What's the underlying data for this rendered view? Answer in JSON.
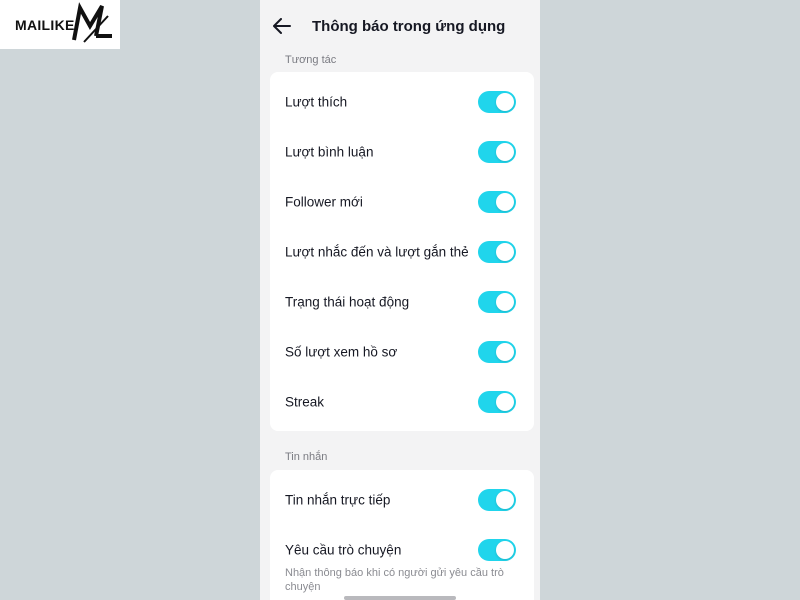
{
  "watermark": {
    "text": "MAILIKE",
    "mark": "ML"
  },
  "header": {
    "title": "Thông báo trong ứng dụng",
    "back_icon": "arrow-left-icon"
  },
  "sections": [
    {
      "label": "Tương tác",
      "items": [
        {
          "label": "Lượt thích",
          "enabled": true
        },
        {
          "label": "Lượt bình luận",
          "enabled": true
        },
        {
          "label": "Follower mới",
          "enabled": true
        },
        {
          "label": "Lượt nhắc đến và lượt gắn thẻ",
          "enabled": true
        },
        {
          "label": "Trạng thái hoạt động",
          "enabled": true
        },
        {
          "label": "Số lượt xem hồ sơ",
          "enabled": true
        },
        {
          "label": "Streak",
          "enabled": true
        }
      ]
    },
    {
      "label": "Tin nhắn",
      "items": [
        {
          "label": "Tin nhắn trực tiếp",
          "enabled": true
        },
        {
          "label": "Yêu cầu trò chuyện",
          "enabled": true,
          "description": "Nhận thông báo khi có người gửi yêu cầu trò chuyện"
        }
      ]
    }
  ],
  "colors": {
    "toggle_on": "#20d5ec",
    "page_bg": "#ced6d9",
    "screen_bg": "#f3f3f4"
  }
}
